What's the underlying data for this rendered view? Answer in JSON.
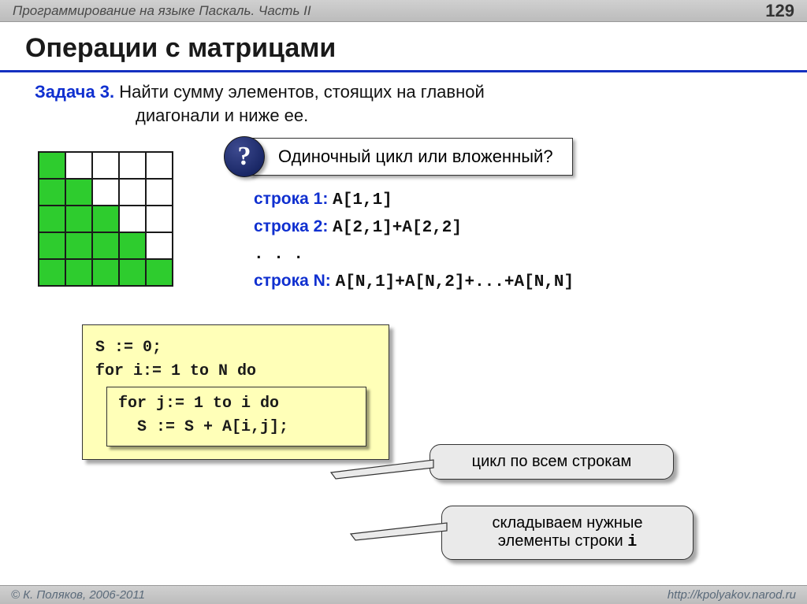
{
  "header": {
    "subtitle": "Программирование на языке Паскаль. Часть II",
    "page": "129"
  },
  "title": "Операции с матрицами",
  "task": {
    "label": "Задача 3.",
    "line1": " Найти сумму элементов, стоящих  на главной",
    "line2": "диагонали и ниже ее."
  },
  "question": {
    "mark": "?",
    "text": "Одиночный цикл или вложенный?"
  },
  "matrix": {
    "n": 5,
    "cells": [
      [
        1,
        0,
        0,
        0,
        0
      ],
      [
        1,
        1,
        0,
        0,
        0
      ],
      [
        1,
        1,
        1,
        0,
        0
      ],
      [
        1,
        1,
        1,
        1,
        0
      ],
      [
        1,
        1,
        1,
        1,
        1
      ]
    ]
  },
  "rows": {
    "r1label": "строка 1:",
    "r1code": "A[1,1]",
    "r2label": "строка 2:",
    "r2code": "A[2,1]+A[2,2]",
    "dots": ". . .",
    "rnlabel": "строка N:",
    "rncode": "A[N,1]+A[N,2]+...+A[N,N]"
  },
  "code": {
    "l1": "S := 0;",
    "l2": "for i:= 1 to N do",
    "l3": "for j:= 1 to i do",
    "l4": "  S := S + A[i,j];"
  },
  "callouts": {
    "c1": "цикл по всем строкам",
    "c2a": "складываем нужные",
    "c2b": "элементы строки ",
    "c2i": "i"
  },
  "footer": {
    "left": "© К. Поляков, 2006-2011",
    "right": "http://kpolyakov.narod.ru"
  }
}
